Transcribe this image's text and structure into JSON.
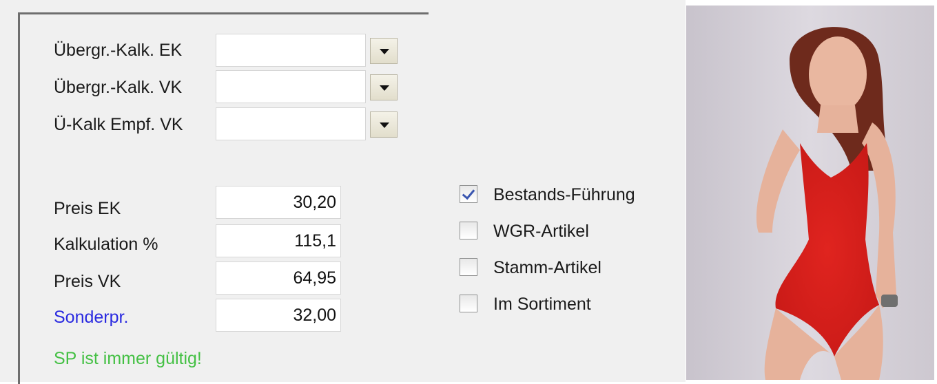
{
  "labels": {
    "uebergr_kalk_ek": "Übergr.-Kalk. EK",
    "uebergr_kalk_vk": "Übergr.-Kalk. VK",
    "ue_kalk_empf_vk": "Ü-Kalk Empf. VK",
    "preis_ek": "Preis EK",
    "kalkulation": "Kalkulation %",
    "preis_vk": "Preis VK",
    "sonderpr": "Sonderpr.",
    "sp_note": "SP ist immer gültig!"
  },
  "fields": {
    "uebergr_kalk_ek": "",
    "uebergr_kalk_vk": "",
    "ue_kalk_empf_vk": "",
    "preis_ek": "30,20",
    "kalkulation": "115,1",
    "preis_vk": "64,95",
    "sonderpr": "32,00"
  },
  "checkboxes": [
    {
      "label": "Bestands-Führung",
      "checked": true
    },
    {
      "label": "WGR-Artikel",
      "checked": false
    },
    {
      "label": "Stamm-Artikel",
      "checked": false
    },
    {
      "label": "Im Sortiment",
      "checked": false
    }
  ],
  "colors": {
    "special_price_label": "#2a2ae0",
    "note": "#44c044",
    "check": "#3a56b0"
  },
  "icons": {
    "dropdown": "chevron-down-icon",
    "check": "checkmark-icon"
  }
}
